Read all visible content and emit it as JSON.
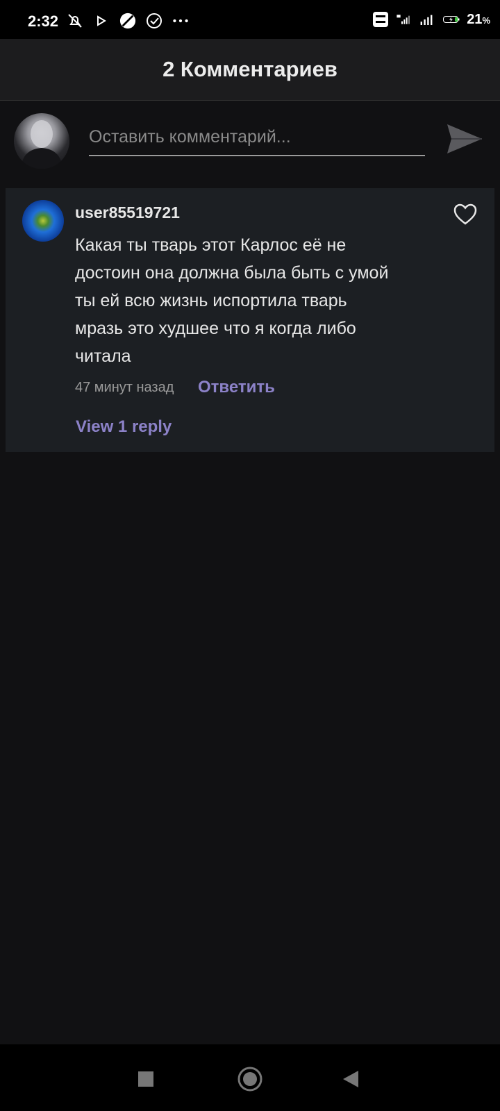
{
  "status_bar": {
    "time": "2:32",
    "battery_value": "21",
    "battery_unit": "%",
    "icons": [
      "bell-off-icon",
      "play-icon",
      "circle-slash-icon",
      "check-circle-icon",
      "more-dots-icon",
      "volte-icon",
      "signal-4g-icon",
      "signal-icon",
      "battery-charging-icon"
    ]
  },
  "header": {
    "title": "2 Комментариев"
  },
  "composer": {
    "placeholder": "Оставить комментарий...",
    "send_icon": "send-icon"
  },
  "comments": [
    {
      "username": "user85519721",
      "text_lines": [
        "Какая ты тварь этот Карлос её не",
        "достоин она должна была быть с умой",
        "ты ей всю жизнь испортила тварь",
        "мразь это худшее что я когда либо",
        "читала"
      ],
      "time": "47 минут назад",
      "reply_label": "Ответить",
      "view_replies_label": "View 1 reply"
    }
  ],
  "colors": {
    "background": "#111113",
    "header": "#1c1c1e",
    "card": "#1c1f23",
    "accent": "#8c82c8"
  }
}
